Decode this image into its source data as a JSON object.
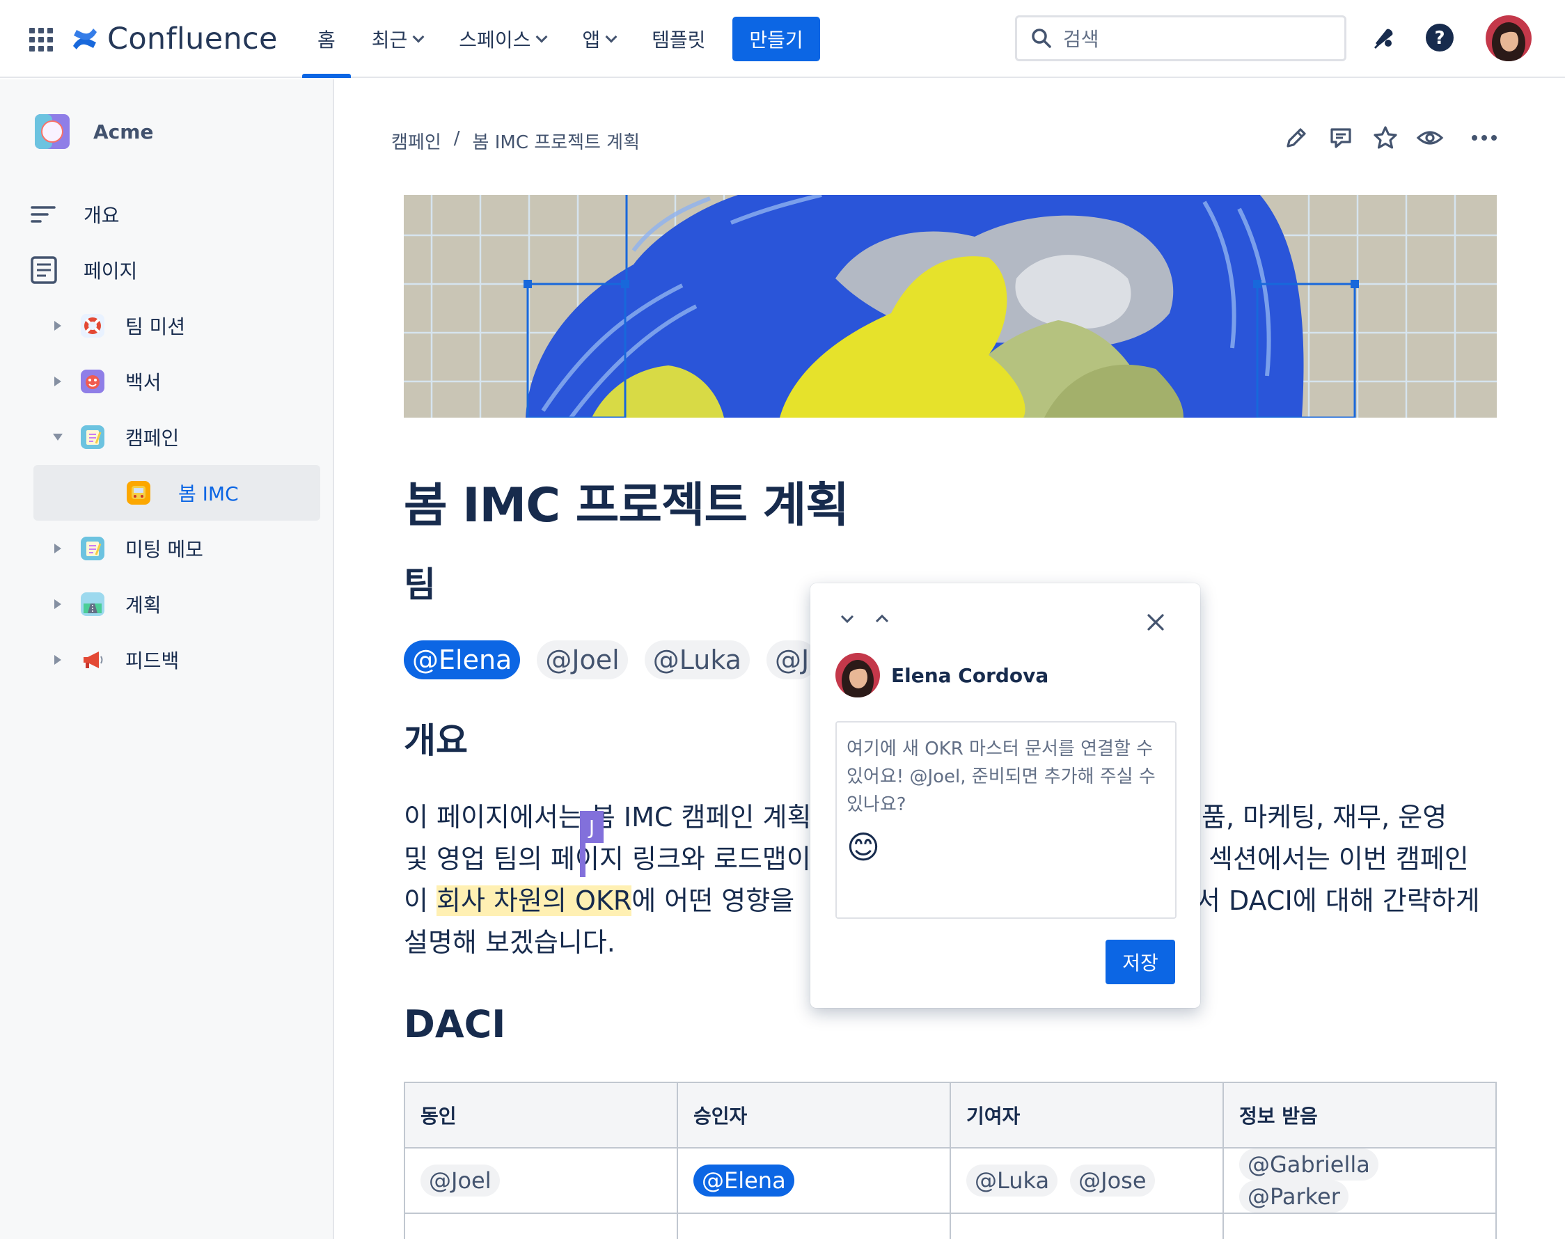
{
  "topbar": {
    "logo_text": "Confluence",
    "nav": [
      {
        "label": "홈"
      },
      {
        "label": "최근"
      },
      {
        "label": "스페이스"
      },
      {
        "label": "앱"
      },
      {
        "label": "템플릿"
      }
    ],
    "create_label": "만들기",
    "search_placeholder": "검색"
  },
  "sidebar": {
    "space_name": "Acme",
    "overview_label": "개요",
    "pages_label": "페이지",
    "tree": [
      {
        "label": "팀 미션",
        "icon": "lifebuoy-icon"
      },
      {
        "label": "백서",
        "icon": "face-icon"
      },
      {
        "label": "캠페인",
        "icon": "notepad-icon"
      },
      {
        "label": "봄 IMC",
        "icon": "bus-icon"
      },
      {
        "label": "미팅 메모",
        "icon": "notepad-icon"
      },
      {
        "label": "계획",
        "icon": "road-icon"
      },
      {
        "label": "피드백",
        "icon": "megaphone-icon"
      }
    ]
  },
  "breadcrumb": {
    "parent": "캠페인",
    "separator": "/",
    "current": "봄 IMC 프로젝트 계획"
  },
  "page": {
    "title": "봄 IMC 프로젝트 계획",
    "team_heading": "팀",
    "team_mentions": [
      "@Elena",
      "@Joel",
      "@Luka",
      "@J"
    ],
    "overview_heading": "개요",
    "overview_lines": [
      {
        "a": "이 페이지에서는 봄 IMC 캠페인 계획",
        "b": "품, 마케팅, 재무, 운영"
      },
      {
        "a": "및 영업 팀의 페이지 링크와 로드맵이",
        "b": "섹션에서는 이번 캠페인"
      },
      {
        "a_pre": "이 ",
        "a_hl": "회사 차원의 OKR",
        "a_post": "에 어떤 영향을",
        "b": "서 DACI에 대해 간략하게"
      },
      {
        "a": "설명해 보겠습니다.",
        "b": ""
      }
    ],
    "cursor_user": "J",
    "daci_heading": "DACI",
    "daci_table": {
      "headers": [
        "동인",
        "승인자",
        "기여자",
        "정보 받음"
      ],
      "row": [
        [
          "@Joel"
        ],
        [
          "@Elena"
        ],
        [
          "@Luka",
          "@Jose"
        ],
        [
          "@Gabriella",
          "@Parker"
        ]
      ]
    }
  },
  "comment": {
    "author": "Elena Cordova",
    "text": "여기에 새 OKR 마스터 문서를 연결할 수 있어요! @Joel, 준비되면 추가해 주실 수 있나요?",
    "emoji": "😊",
    "save_label": "저장"
  },
  "colors": {
    "brand_blue": "#0C66E4",
    "highlight": "#FFF0B3",
    "cursor_purple": "#8270DB"
  }
}
